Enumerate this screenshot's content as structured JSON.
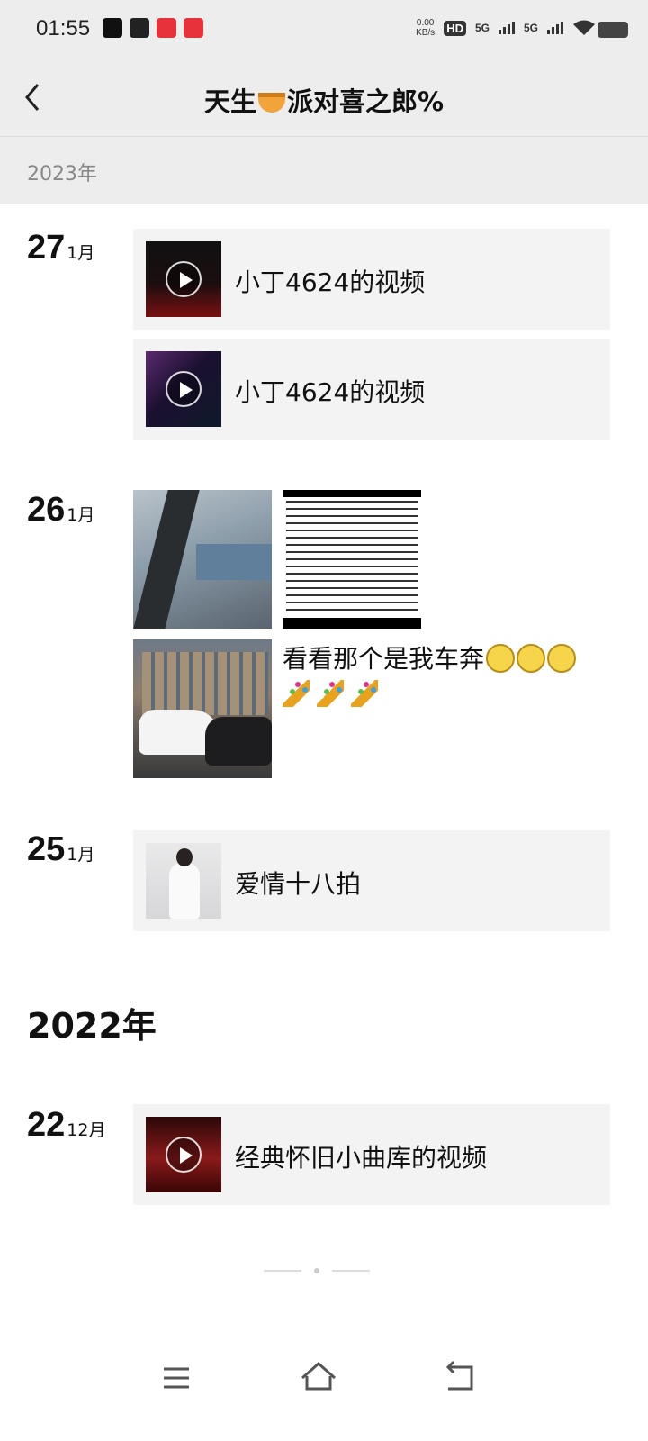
{
  "status_bar": {
    "time": "01:55",
    "app_icons": [
      "tiktok-icon",
      "soul-icon",
      "app-icon",
      "app-icon"
    ],
    "net_speed_value": "0.00",
    "net_speed_unit": "KB/s",
    "hd_label": "HD",
    "network_1": "5G",
    "network_2": "5G"
  },
  "header": {
    "back_icon": "chevron-left-icon",
    "title_before": "天生",
    "title_emoji": "pie-emoji",
    "title_after": "派对喜之郎%"
  },
  "year_bar": {
    "label": "2023年"
  },
  "groups": [
    {
      "day": "27",
      "month": "1月",
      "entries": [
        {
          "type": "video",
          "text": "小丁4624的视频"
        },
        {
          "type": "video",
          "text": "小丁4624的视频"
        }
      ]
    },
    {
      "day": "26",
      "month": "1月",
      "post_text": "看看那个是我车奔",
      "emojis": [
        "smile-emoji",
        "smile-emoji",
        "smile-emoji",
        "party-popper-emoji",
        "party-popper-emoji",
        "party-popper-emoji"
      ]
    },
    {
      "day": "25",
      "month": "1月",
      "entries": [
        {
          "type": "music",
          "text": "爱情十八拍"
        }
      ]
    }
  ],
  "year_2022": "2022年",
  "groups_2022": [
    {
      "day": "22",
      "month": "12月",
      "entries": [
        {
          "type": "video",
          "text": "经典怀旧小曲库的视频"
        }
      ]
    }
  ],
  "nav_bar": {
    "menu_icon": "menu-icon",
    "home_icon": "home-icon",
    "back_icon": "back-icon"
  },
  "colors": {
    "header_bg": "#ededed",
    "entry_bg": "#f3f3f3",
    "text": "#111111",
    "muted": "#888888"
  }
}
